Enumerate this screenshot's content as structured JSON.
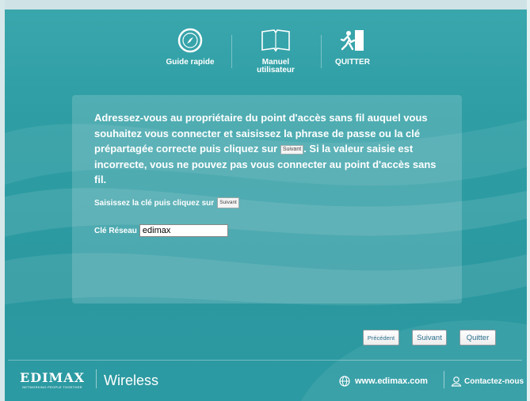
{
  "nav": {
    "quick_guide": "Guide rapide",
    "manual_line1": "Manuel",
    "manual_line2": "utilisateur",
    "quit": "QUITTER"
  },
  "message": {
    "part1": "Adressez-vous au propriétaire du point d'accès sans fil auquel vous souhaitez vous connecter et saisissez la phrase de passe ou la clé prépartagée correcte puis cliquez sur ",
    "inline_button": "Suivant",
    "part2": ". Si la valeur saisie est incorrecte, vous ne pouvez pas vous connecter au point d'accès sans fil."
  },
  "instruction": {
    "text": "Saisissez la clé puis cliquez sur",
    "inline_button": "Suivant"
  },
  "key": {
    "label": "Clé Réseau",
    "value": "edimax"
  },
  "buttons": {
    "previous": "Précédent",
    "next": "Suivant",
    "quit": "Quitter"
  },
  "footer": {
    "logo": "EDIMAX",
    "tagline": "NETWORKING PEOPLE TOGETHER",
    "product": "Wireless",
    "website": "www.edimax.com",
    "contact": "Contactez-nous"
  },
  "colors": {
    "background": "#2e9ea4",
    "text": "#ffffff",
    "button_text": "#2b6f8e"
  }
}
